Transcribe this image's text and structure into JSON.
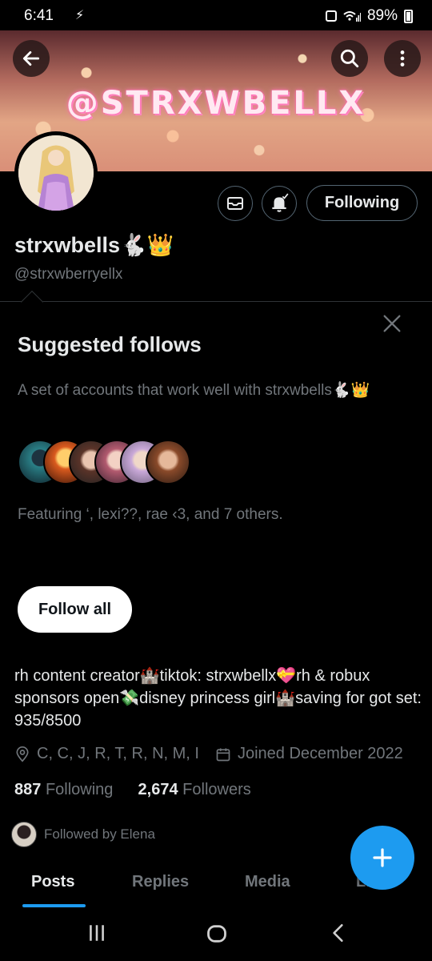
{
  "status_bar": {
    "time": "6:41",
    "notif_glyph": "⚡",
    "battery": "89%"
  },
  "banner": {
    "title": "@STRXWBELLX"
  },
  "header_buttons": {
    "following_label": "Following"
  },
  "profile": {
    "display_name": "strxwbells🐇👑",
    "handle": "@strxwberryellx",
    "bio": "rh content creator🏰tiktok: strxwbellx💝rh & robux sponsors open💸disney princess girl🏰saving for got set: 935/8500",
    "location": "C, C, J, R, T, R, N, M, I",
    "joined": "Joined December 2022",
    "following_count": "887",
    "following_label": "Following",
    "followers_count": "2,674",
    "followers_label": "Followers",
    "followed_by": "Followed by Elena"
  },
  "suggested": {
    "title": "Suggested follows",
    "description": "A set of accounts that work well with strxwbells🐇👑",
    "featuring": "Featuring ‘, lexi??, rae ‹3, and 7 others.",
    "follow_all_label": "Follow all"
  },
  "tabs": [
    {
      "label": "Posts",
      "active": true
    },
    {
      "label": "Replies",
      "active": false
    },
    {
      "label": "Media",
      "active": false
    },
    {
      "label": "Likes",
      "active": false
    }
  ],
  "colors": {
    "accent": "#1d9bf0",
    "muted": "#71767b",
    "text": "#e7e9ea",
    "border": "#536471"
  },
  "icons": [
    "back-arrow-icon",
    "search-icon",
    "more-vertical-icon",
    "mail-icon",
    "bell-icon",
    "close-icon",
    "location-icon",
    "calendar-icon",
    "plus-icon",
    "recents-icon",
    "home-icon",
    "back-icon"
  ]
}
